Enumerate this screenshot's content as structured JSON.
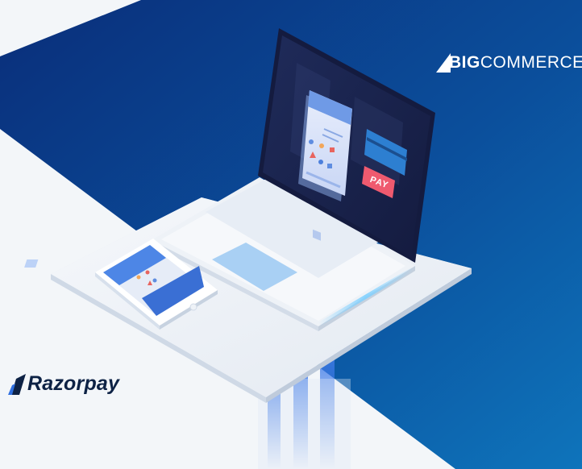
{
  "brands": {
    "bigcommerce": {
      "big": "BIG",
      "commerce": "COMMERCE",
      "color": "#ffffff"
    },
    "razorpay": {
      "name": "Razorpay",
      "color": "#0d2245",
      "accent": "#2f6fe0"
    }
  },
  "laptop_screen": {
    "pay_button": "PAY",
    "pay_color": "#ef5a6f"
  },
  "colors": {
    "background_light": "#f3f6f9",
    "background_dark": "#0b3a8a",
    "background_blue": "#0f6bb3"
  }
}
